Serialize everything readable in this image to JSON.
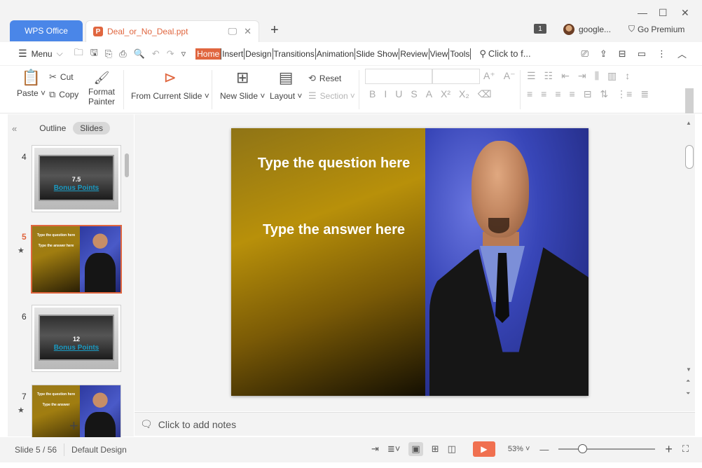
{
  "titlebar": {
    "app_tab": "WPS Office",
    "doc_tab": "Deal_or_No_Deal.ppt",
    "ppt_icon_letter": "P",
    "new_tab": "+",
    "notif_count": "1",
    "user": "google...",
    "premium": "Go Premium",
    "win_min": "—",
    "win_max": "☐",
    "win_close": "✕",
    "tab_monitor": "🖵",
    "tab_close": "✕"
  },
  "menurow": {
    "menu": "Menu",
    "tabs": [
      "Home",
      "Insert",
      "Design",
      "Transitions",
      "Animation",
      "Slide Show",
      "Review",
      "View",
      "Tools"
    ],
    "active_tab": "Home",
    "search_placeholder": "Click to f..."
  },
  "ribbon": {
    "paste": "Paste",
    "cut": "Cut",
    "copy": "Copy",
    "format_painter_1": "Format",
    "format_painter_2": "Painter",
    "from_current_slide": "From Current Slide",
    "new_slide": "New Slide",
    "layout": "Layout",
    "reset": "Reset",
    "section": "Section",
    "font_controls": [
      "B",
      "I",
      "U",
      "S",
      "A",
      "X²",
      "X₂"
    ]
  },
  "leftpanel": {
    "outline_tab": "Outline",
    "slides_tab": "Slides",
    "thumbs": [
      {
        "num": "4",
        "type": "case",
        "value": "7.5",
        "label": "Bonus Points"
      },
      {
        "num": "5",
        "type": "qa",
        "q": "Type the question here",
        "a": "Type the answer here"
      },
      {
        "num": "6",
        "type": "case",
        "value": "12",
        "label": "Bonus Points"
      },
      {
        "num": "7",
        "type": "qa",
        "q": "Type the question here",
        "a": "Type the answer"
      }
    ],
    "add": "+"
  },
  "slide": {
    "question": "Type the question here",
    "answer": "Type the answer here"
  },
  "notes": {
    "placeholder": "Click to add notes"
  },
  "statusbar": {
    "slide_info": "Slide 5 / 56",
    "design": "Default Design",
    "zoom": "53%",
    "zoom_level": 0.53
  },
  "colors": {
    "accent": "#e0663f",
    "wps_blue": "#4a86e8"
  }
}
